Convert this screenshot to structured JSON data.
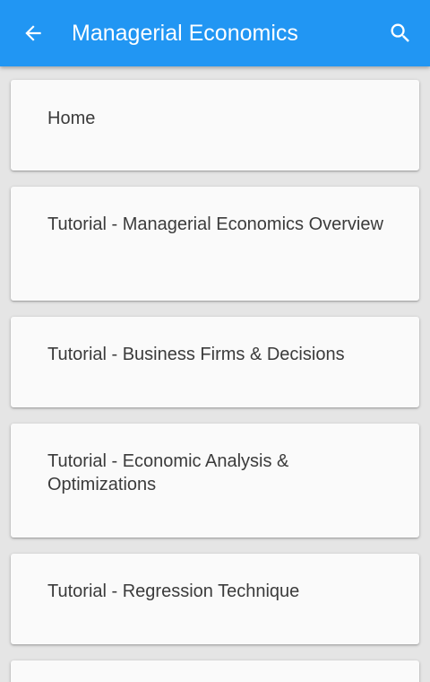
{
  "appbar": {
    "title": "Managerial Economics",
    "back_icon": "arrow-left-icon",
    "search_icon": "search-icon",
    "color": "#2196f3"
  },
  "list": {
    "items": [
      {
        "label": "Home"
      },
      {
        "label": "Tutorial - Managerial Economics Overview"
      },
      {
        "label": "Tutorial - Business Firms & Decisions"
      },
      {
        "label": "Tutorial - Economic Analysis & Optimizations"
      },
      {
        "label": "Tutorial - Regression Technique"
      },
      {
        "label": ""
      }
    ]
  }
}
